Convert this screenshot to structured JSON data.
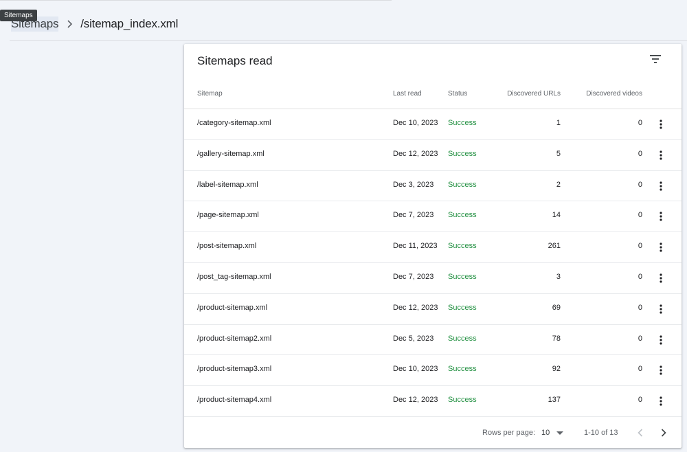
{
  "tooltip": "Sitemaps",
  "breadcrumb": {
    "parent": "Sitemaps",
    "current": "/sitemap_index.xml"
  },
  "card": {
    "title": "Sitemaps read",
    "columns": {
      "sitemap": "Sitemap",
      "last_read": "Last read",
      "status": "Status",
      "discovered_urls": "Discovered URLs",
      "discovered_videos": "Discovered videos"
    },
    "rows": [
      {
        "sitemap": "/category-sitemap.xml",
        "last_read": "Dec 10, 2023",
        "status": "Success",
        "urls": "1",
        "videos": "0"
      },
      {
        "sitemap": "/gallery-sitemap.xml",
        "last_read": "Dec 12, 2023",
        "status": "Success",
        "urls": "5",
        "videos": "0"
      },
      {
        "sitemap": "/label-sitemap.xml",
        "last_read": "Dec 3, 2023",
        "status": "Success",
        "urls": "2",
        "videos": "0"
      },
      {
        "sitemap": "/page-sitemap.xml",
        "last_read": "Dec 7, 2023",
        "status": "Success",
        "urls": "14",
        "videos": "0"
      },
      {
        "sitemap": "/post-sitemap.xml",
        "last_read": "Dec 11, 2023",
        "status": "Success",
        "urls": "261",
        "videos": "0"
      },
      {
        "sitemap": "/post_tag-sitemap.xml",
        "last_read": "Dec 7, 2023",
        "status": "Success",
        "urls": "3",
        "videos": "0"
      },
      {
        "sitemap": "/product-sitemap.xml",
        "last_read": "Dec 12, 2023",
        "status": "Success",
        "urls": "69",
        "videos": "0"
      },
      {
        "sitemap": "/product-sitemap2.xml",
        "last_read": "Dec 5, 2023",
        "status": "Success",
        "urls": "78",
        "videos": "0"
      },
      {
        "sitemap": "/product-sitemap3.xml",
        "last_read": "Dec 10, 2023",
        "status": "Success",
        "urls": "92",
        "videos": "0"
      },
      {
        "sitemap": "/product-sitemap4.xml",
        "last_read": "Dec 12, 2023",
        "status": "Success",
        "urls": "137",
        "videos": "0"
      }
    ],
    "footer": {
      "rows_per_page_label": "Rows per page:",
      "rows_per_page_value": "10",
      "range": "1-10 of 13"
    }
  },
  "colors": {
    "success": "#1e8e3e",
    "background": "#f1f4f9",
    "card": "#ffffff"
  },
  "icons": {
    "breadcrumb_separator": "chevron-right-icon",
    "filter": "filter-list-icon",
    "row_menu": "more-vert-icon",
    "dropdown": "arrow-drop-down-icon",
    "prev_page": "chevron-left-icon",
    "next_page": "chevron-right-icon"
  }
}
